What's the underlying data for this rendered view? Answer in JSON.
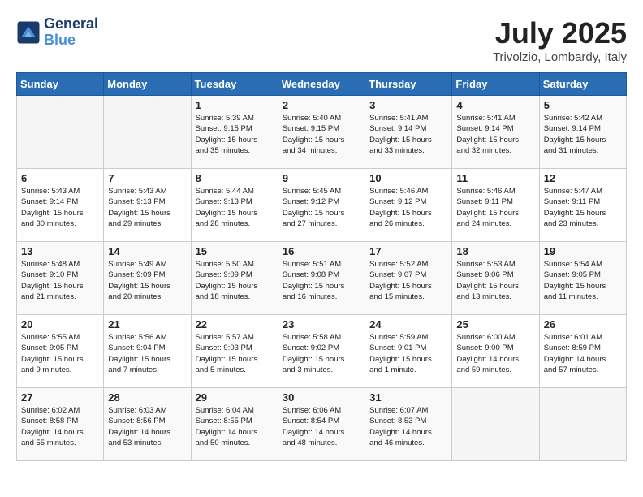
{
  "header": {
    "logo_line1": "General",
    "logo_line2": "Blue",
    "month_year": "July 2025",
    "location": "Trivolzio, Lombardy, Italy"
  },
  "weekdays": [
    "Sunday",
    "Monday",
    "Tuesday",
    "Wednesday",
    "Thursday",
    "Friday",
    "Saturday"
  ],
  "weeks": [
    [
      {
        "day": "",
        "info": ""
      },
      {
        "day": "",
        "info": ""
      },
      {
        "day": "1",
        "info": "Sunrise: 5:39 AM\nSunset: 9:15 PM\nDaylight: 15 hours\nand 35 minutes."
      },
      {
        "day": "2",
        "info": "Sunrise: 5:40 AM\nSunset: 9:15 PM\nDaylight: 15 hours\nand 34 minutes."
      },
      {
        "day": "3",
        "info": "Sunrise: 5:41 AM\nSunset: 9:14 PM\nDaylight: 15 hours\nand 33 minutes."
      },
      {
        "day": "4",
        "info": "Sunrise: 5:41 AM\nSunset: 9:14 PM\nDaylight: 15 hours\nand 32 minutes."
      },
      {
        "day": "5",
        "info": "Sunrise: 5:42 AM\nSunset: 9:14 PM\nDaylight: 15 hours\nand 31 minutes."
      }
    ],
    [
      {
        "day": "6",
        "info": "Sunrise: 5:43 AM\nSunset: 9:14 PM\nDaylight: 15 hours\nand 30 minutes."
      },
      {
        "day": "7",
        "info": "Sunrise: 5:43 AM\nSunset: 9:13 PM\nDaylight: 15 hours\nand 29 minutes."
      },
      {
        "day": "8",
        "info": "Sunrise: 5:44 AM\nSunset: 9:13 PM\nDaylight: 15 hours\nand 28 minutes."
      },
      {
        "day": "9",
        "info": "Sunrise: 5:45 AM\nSunset: 9:12 PM\nDaylight: 15 hours\nand 27 minutes."
      },
      {
        "day": "10",
        "info": "Sunrise: 5:46 AM\nSunset: 9:12 PM\nDaylight: 15 hours\nand 26 minutes."
      },
      {
        "day": "11",
        "info": "Sunrise: 5:46 AM\nSunset: 9:11 PM\nDaylight: 15 hours\nand 24 minutes."
      },
      {
        "day": "12",
        "info": "Sunrise: 5:47 AM\nSunset: 9:11 PM\nDaylight: 15 hours\nand 23 minutes."
      }
    ],
    [
      {
        "day": "13",
        "info": "Sunrise: 5:48 AM\nSunset: 9:10 PM\nDaylight: 15 hours\nand 21 minutes."
      },
      {
        "day": "14",
        "info": "Sunrise: 5:49 AM\nSunset: 9:09 PM\nDaylight: 15 hours\nand 20 minutes."
      },
      {
        "day": "15",
        "info": "Sunrise: 5:50 AM\nSunset: 9:09 PM\nDaylight: 15 hours\nand 18 minutes."
      },
      {
        "day": "16",
        "info": "Sunrise: 5:51 AM\nSunset: 9:08 PM\nDaylight: 15 hours\nand 16 minutes."
      },
      {
        "day": "17",
        "info": "Sunrise: 5:52 AM\nSunset: 9:07 PM\nDaylight: 15 hours\nand 15 minutes."
      },
      {
        "day": "18",
        "info": "Sunrise: 5:53 AM\nSunset: 9:06 PM\nDaylight: 15 hours\nand 13 minutes."
      },
      {
        "day": "19",
        "info": "Sunrise: 5:54 AM\nSunset: 9:05 PM\nDaylight: 15 hours\nand 11 minutes."
      }
    ],
    [
      {
        "day": "20",
        "info": "Sunrise: 5:55 AM\nSunset: 9:05 PM\nDaylight: 15 hours\nand 9 minutes."
      },
      {
        "day": "21",
        "info": "Sunrise: 5:56 AM\nSunset: 9:04 PM\nDaylight: 15 hours\nand 7 minutes."
      },
      {
        "day": "22",
        "info": "Sunrise: 5:57 AM\nSunset: 9:03 PM\nDaylight: 15 hours\nand 5 minutes."
      },
      {
        "day": "23",
        "info": "Sunrise: 5:58 AM\nSunset: 9:02 PM\nDaylight: 15 hours\nand 3 minutes."
      },
      {
        "day": "24",
        "info": "Sunrise: 5:59 AM\nSunset: 9:01 PM\nDaylight: 15 hours\nand 1 minute."
      },
      {
        "day": "25",
        "info": "Sunrise: 6:00 AM\nSunset: 9:00 PM\nDaylight: 14 hours\nand 59 minutes."
      },
      {
        "day": "26",
        "info": "Sunrise: 6:01 AM\nSunset: 8:59 PM\nDaylight: 14 hours\nand 57 minutes."
      }
    ],
    [
      {
        "day": "27",
        "info": "Sunrise: 6:02 AM\nSunset: 8:58 PM\nDaylight: 14 hours\nand 55 minutes."
      },
      {
        "day": "28",
        "info": "Sunrise: 6:03 AM\nSunset: 8:56 PM\nDaylight: 14 hours\nand 53 minutes."
      },
      {
        "day": "29",
        "info": "Sunrise: 6:04 AM\nSunset: 8:55 PM\nDaylight: 14 hours\nand 50 minutes."
      },
      {
        "day": "30",
        "info": "Sunrise: 6:06 AM\nSunset: 8:54 PM\nDaylight: 14 hours\nand 48 minutes."
      },
      {
        "day": "31",
        "info": "Sunrise: 6:07 AM\nSunset: 8:53 PM\nDaylight: 14 hours\nand 46 minutes."
      },
      {
        "day": "",
        "info": ""
      },
      {
        "day": "",
        "info": ""
      }
    ]
  ]
}
